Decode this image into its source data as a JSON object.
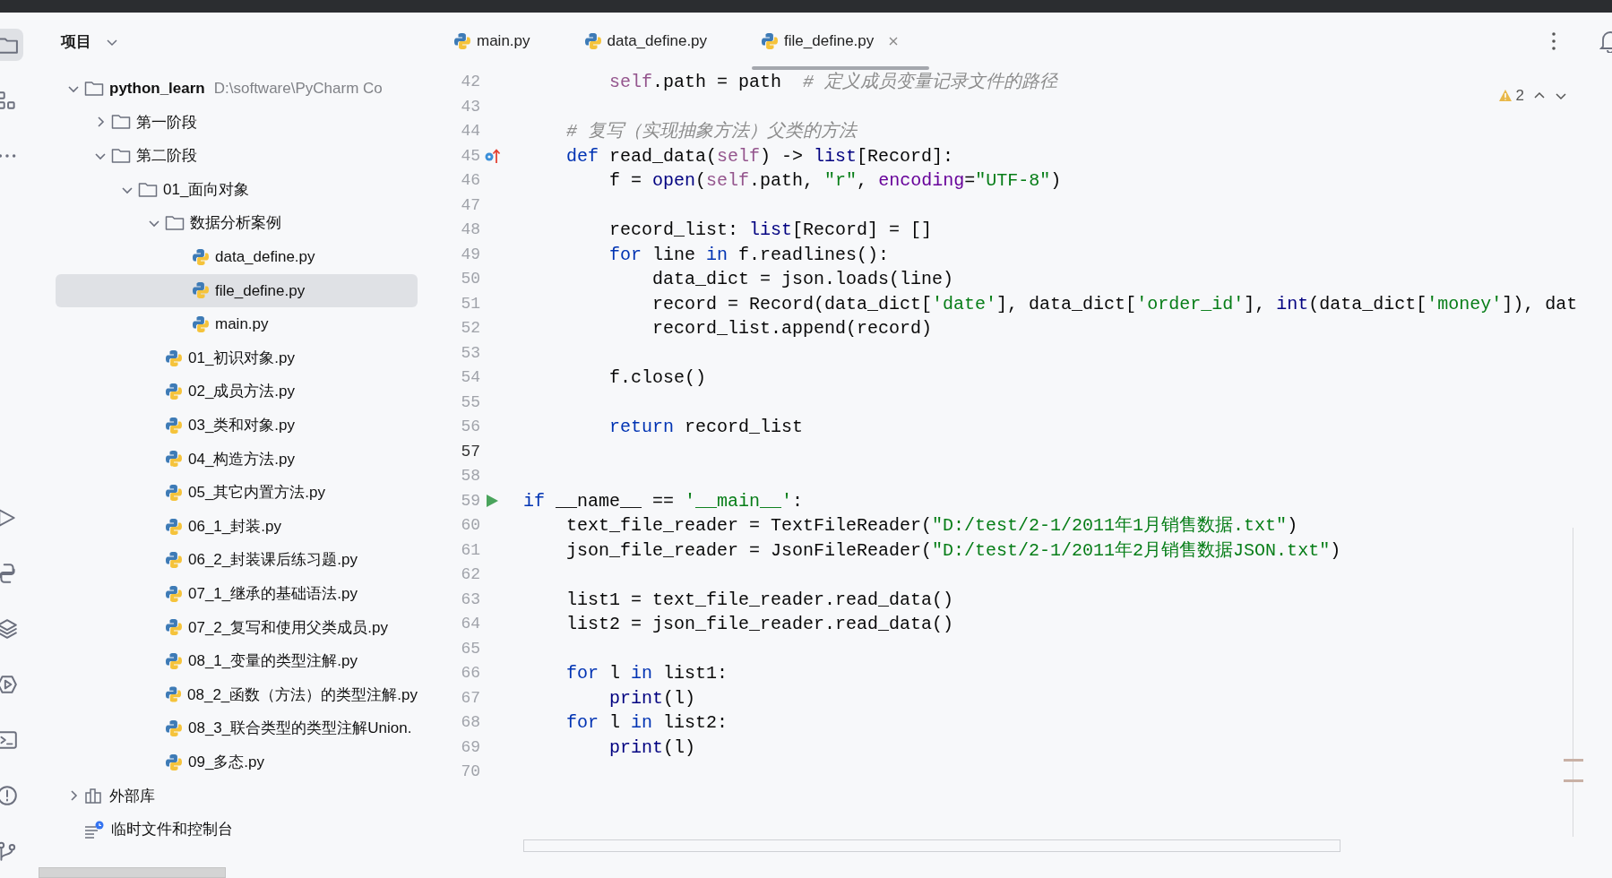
{
  "tool_strip": {
    "top": [
      {
        "kind": "project",
        "selected": true
      },
      {
        "kind": "structure",
        "selected": false
      },
      {
        "kind": "more",
        "selected": false
      }
    ],
    "bottom": [
      {
        "kind": "run",
        "selected": false
      },
      {
        "kind": "python",
        "selected": false
      },
      {
        "kind": "layers",
        "selected": false
      },
      {
        "kind": "services",
        "selected": false
      },
      {
        "kind": "terminal",
        "selected": false
      },
      {
        "kind": "problems",
        "selected": false
      },
      {
        "kind": "git",
        "selected": false
      }
    ]
  },
  "project_panel": {
    "title": "项目",
    "tree": [
      {
        "kind": "folder",
        "label": "python_learn",
        "path": "D:\\software\\PyCharm Co",
        "expanded": true,
        "selected": false,
        "children": [
          {
            "kind": "folder",
            "label": "第一阶段",
            "expanded": false,
            "selected": false
          },
          {
            "kind": "folder",
            "label": "第二阶段",
            "expanded": true,
            "selected": false,
            "children": [
              {
                "kind": "folder",
                "label": "01_面向对象",
                "expanded": true,
                "selected": false,
                "children": [
                  {
                    "kind": "folder",
                    "label": "数据分析案例",
                    "expanded": true,
                    "selected": false,
                    "children": [
                      {
                        "kind": "python",
                        "label": "data_define.py",
                        "selected": false
                      },
                      {
                        "kind": "python",
                        "label": "file_define.py",
                        "selected": true
                      },
                      {
                        "kind": "python",
                        "label": "main.py",
                        "selected": false
                      }
                    ]
                  },
                  {
                    "kind": "python",
                    "label": "01_初识对象.py",
                    "selected": false
                  },
                  {
                    "kind": "python",
                    "label": "02_成员方法.py",
                    "selected": false
                  },
                  {
                    "kind": "python",
                    "label": "03_类和对象.py",
                    "selected": false
                  },
                  {
                    "kind": "python",
                    "label": "04_构造方法.py",
                    "selected": false
                  },
                  {
                    "kind": "python",
                    "label": "05_其它内置方法.py",
                    "selected": false
                  },
                  {
                    "kind": "python",
                    "label": "06_1_封装.py",
                    "selected": false
                  },
                  {
                    "kind": "python",
                    "label": "06_2_封装课后练习题.py",
                    "selected": false
                  },
                  {
                    "kind": "python",
                    "label": "07_1_继承的基础语法.py",
                    "selected": false
                  },
                  {
                    "kind": "python",
                    "label": "07_2_复写和使用父类成员.py",
                    "selected": false
                  },
                  {
                    "kind": "python",
                    "label": "08_1_变量的类型注解.py",
                    "selected": false
                  },
                  {
                    "kind": "python",
                    "label": "08_2_函数（方法）的类型注解.py",
                    "selected": false
                  },
                  {
                    "kind": "python",
                    "label": "08_3_联合类型的类型注解Union.",
                    "selected": false
                  },
                  {
                    "kind": "python",
                    "label": "09_多态.py",
                    "selected": false
                  }
                ]
              }
            ]
          }
        ]
      },
      {
        "kind": "library",
        "label": "外部库",
        "expanded": false,
        "selected": false
      },
      {
        "kind": "scratch",
        "label": "临时文件和控制台",
        "selected": false
      }
    ]
  },
  "editor": {
    "tabs": [
      {
        "label": "main.py",
        "selected": false
      },
      {
        "label": "data_define.py",
        "selected": false
      },
      {
        "label": "file_define.py",
        "selected": true
      }
    ],
    "warnings": "2",
    "lines": [
      {
        "number": "42",
        "tokens": [
          {
            "kind": "self",
            "text": "        self"
          },
          {
            "kind": "plain",
            "text": ".path = path  "
          },
          {
            "kind": "comment",
            "text": "# 定义成员变量记录文件的路径"
          }
        ]
      },
      {
        "number": "43"
      },
      {
        "number": "44",
        "tokens": [
          {
            "kind": "comment",
            "text": "    # 复写（实现抽象方法）父类的方法"
          }
        ]
      },
      {
        "number": "45",
        "kind": "override",
        "tokens": [
          {
            "kind": "keyword",
            "text": "    def"
          },
          {
            "kind": "plain",
            "text": " read_data("
          },
          {
            "kind": "self",
            "text": "self"
          },
          {
            "kind": "plain",
            "text": ") -> "
          },
          {
            "kind": "builtin",
            "text": "list"
          },
          {
            "kind": "plain",
            "text": "[Record]:"
          }
        ]
      },
      {
        "number": "46",
        "tokens": [
          {
            "kind": "plain",
            "text": "        f = "
          },
          {
            "kind": "builtin",
            "text": "open"
          },
          {
            "kind": "plain",
            "text": "("
          },
          {
            "kind": "self",
            "text": "self"
          },
          {
            "kind": "plain",
            "text": ".path, "
          },
          {
            "kind": "string",
            "text": "\"r\""
          },
          {
            "kind": "plain",
            "text": ", "
          },
          {
            "kind": "kwarg",
            "text": "encoding"
          },
          {
            "kind": "plain",
            "text": "="
          },
          {
            "kind": "string",
            "text": "\"UTF-8\""
          },
          {
            "kind": "plain",
            "text": ")"
          }
        ]
      },
      {
        "number": "47"
      },
      {
        "number": "48",
        "tokens": [
          {
            "kind": "plain",
            "text": "        record_list: "
          },
          {
            "kind": "builtin",
            "text": "list"
          },
          {
            "kind": "plain",
            "text": "[Record] = []"
          }
        ]
      },
      {
        "number": "49",
        "tokens": [
          {
            "kind": "keyword",
            "text": "        for"
          },
          {
            "kind": "plain",
            "text": " line "
          },
          {
            "kind": "keyword",
            "text": "in"
          },
          {
            "kind": "plain",
            "text": " f.readlines():"
          }
        ]
      },
      {
        "number": "50",
        "tokens": [
          {
            "kind": "plain",
            "text": "            data_dict = json.loads(line)"
          }
        ]
      },
      {
        "number": "51",
        "tokens": [
          {
            "kind": "plain",
            "text": "            record = Record(data_dict["
          },
          {
            "kind": "string",
            "text": "'date'"
          },
          {
            "kind": "plain",
            "text": "], data_dict["
          },
          {
            "kind": "string",
            "text": "'order_id'"
          },
          {
            "kind": "plain",
            "text": "], "
          },
          {
            "kind": "builtin",
            "text": "int"
          },
          {
            "kind": "plain",
            "text": "(data_dict["
          },
          {
            "kind": "string",
            "text": "'money'"
          },
          {
            "kind": "plain",
            "text": "]), dat"
          }
        ]
      },
      {
        "number": "52",
        "tokens": [
          {
            "kind": "plain",
            "text": "            record_list.append(record)"
          }
        ]
      },
      {
        "number": "53"
      },
      {
        "number": "54",
        "tokens": [
          {
            "kind": "plain",
            "text": "        f.close()"
          }
        ]
      },
      {
        "number": "55"
      },
      {
        "number": "56",
        "tokens": [
          {
            "kind": "keyword",
            "text": "        return"
          },
          {
            "kind": "plain",
            "text": " record_list"
          }
        ]
      },
      {
        "number": "57",
        "current": true
      },
      {
        "number": "58"
      },
      {
        "number": "59",
        "kind": "run",
        "tokens": [
          {
            "kind": "keyword",
            "text": "if"
          },
          {
            "kind": "plain",
            "text": " __name__ == "
          },
          {
            "kind": "string",
            "text": "'__main__'"
          },
          {
            "kind": "plain",
            "text": ":"
          }
        ]
      },
      {
        "number": "60",
        "tokens": [
          {
            "kind": "plain",
            "text": "    text_file_reader = TextFileReader("
          },
          {
            "kind": "string",
            "text": "\"D:/test/2-1/2011年1月销售数据.txt\""
          },
          {
            "kind": "plain",
            "text": ")"
          }
        ]
      },
      {
        "number": "61",
        "tokens": [
          {
            "kind": "plain",
            "text": "    json_file_reader = JsonFileReader("
          },
          {
            "kind": "string",
            "text": "\"D:/test/2-1/2011年2月销售数据JSON.txt\""
          },
          {
            "kind": "plain",
            "text": ")"
          }
        ]
      },
      {
        "number": "62"
      },
      {
        "number": "63",
        "tokens": [
          {
            "kind": "plain",
            "text": "    list1 = text_file_reader.read_data()"
          }
        ]
      },
      {
        "number": "64",
        "tokens": [
          {
            "kind": "plain",
            "text": "    list2 = json_file_reader.read_data()"
          }
        ]
      },
      {
        "number": "65"
      },
      {
        "number": "66",
        "tokens": [
          {
            "kind": "keyword",
            "text": "    for"
          },
          {
            "kind": "plain",
            "text": " l "
          },
          {
            "kind": "keyword",
            "text": "in"
          },
          {
            "kind": "plain",
            "text": " list1:"
          }
        ]
      },
      {
        "number": "67",
        "tokens": [
          {
            "kind": "builtin",
            "text": "        print"
          },
          {
            "kind": "plain",
            "text": "(l)"
          }
        ]
      },
      {
        "number": "68",
        "tokens": [
          {
            "kind": "keyword",
            "text": "    for"
          },
          {
            "kind": "plain",
            "text": " l "
          },
          {
            "kind": "keyword",
            "text": "in"
          },
          {
            "kind": "plain",
            "text": " list2:"
          }
        ]
      },
      {
        "number": "69",
        "tokens": [
          {
            "kind": "builtin",
            "text": "        print"
          },
          {
            "kind": "plain",
            "text": "(l)"
          }
        ]
      },
      {
        "number": "70"
      }
    ]
  }
}
